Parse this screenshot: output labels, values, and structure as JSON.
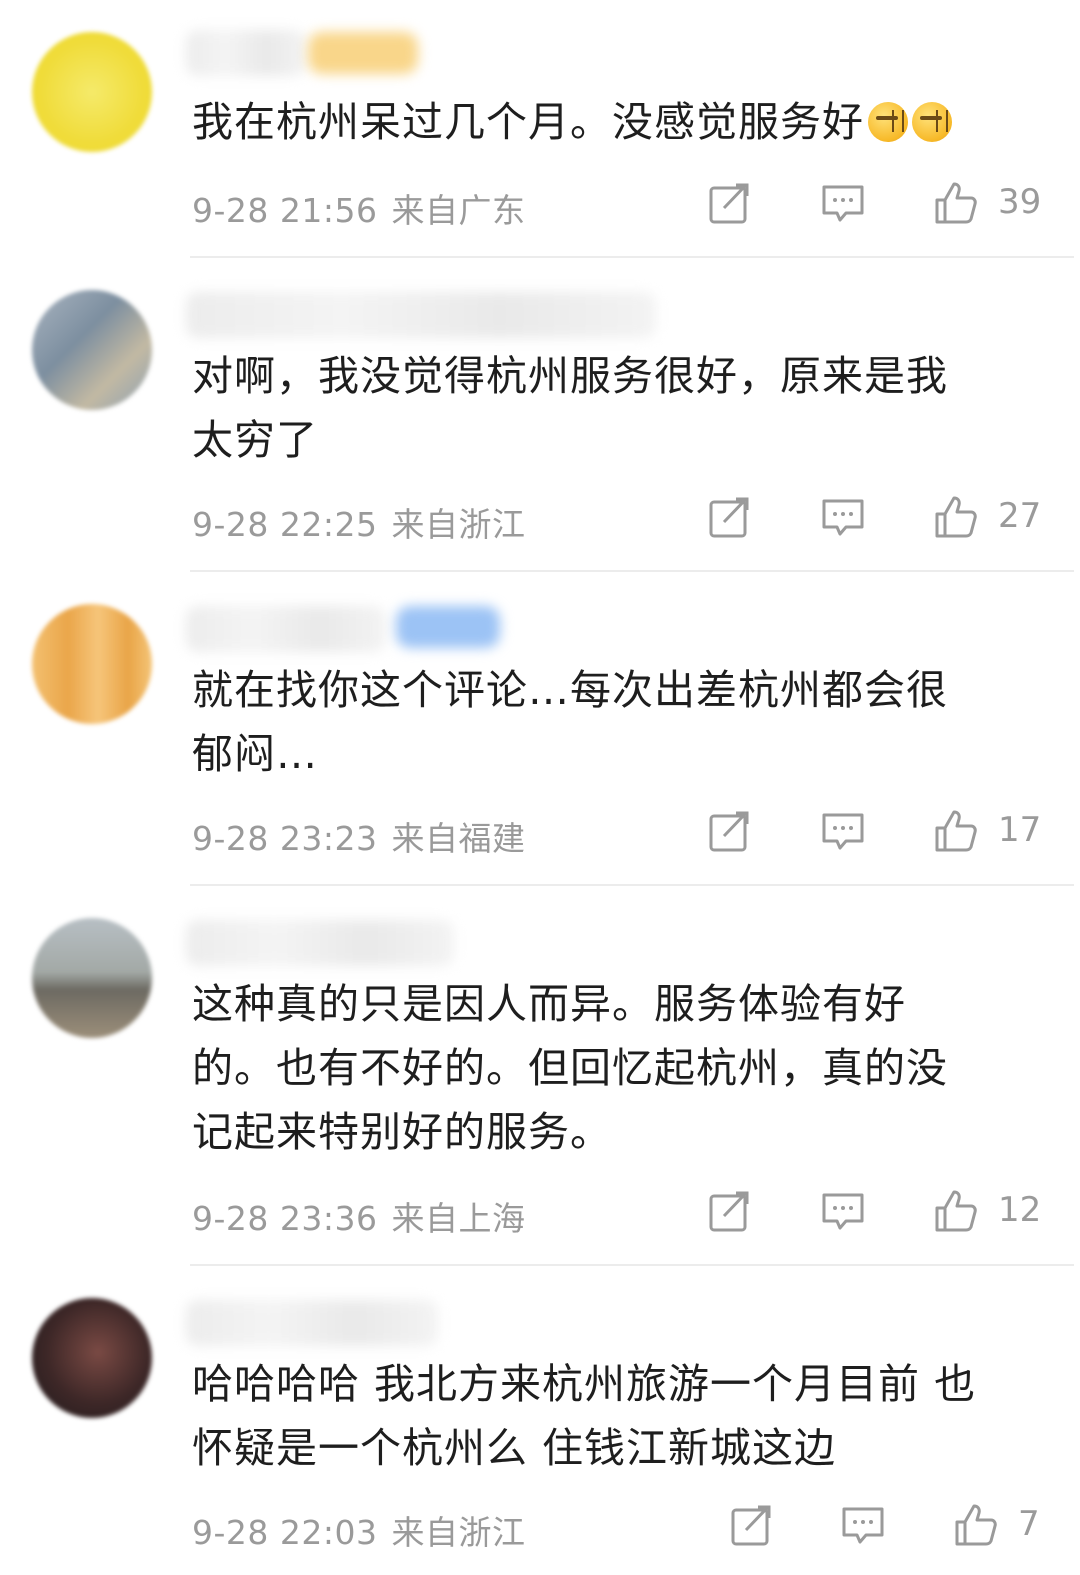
{
  "comments": [
    {
      "text": "我在杭州呆过几个月。没感觉服务好",
      "date": "9-28 21:56",
      "location": "来自广东",
      "likes": "39",
      "emoji_icons": [
        "smirk-emoji-icon",
        "smirk-emoji-icon"
      ],
      "avatar_color": "#f2e04a"
    },
    {
      "text": "对啊，我没觉得杭州服务很好，原来是我\n太穷了",
      "date": "9-28 22:25",
      "location": "来自浙江",
      "likes": "27",
      "avatar_color": "#8c9fb3"
    },
    {
      "text": "就在找你这个评论…每次出差杭州都会很\n郁闷…",
      "date": "9-28 23:23",
      "location": "来自福建",
      "likes": "17",
      "avatar_color": "#f0b25a"
    },
    {
      "text": "这种真的只是因人而异。服务体验有好\n的。也有不好的。但回忆起杭州，真的没\n记起来特别好的服务。",
      "date": "9-28 23:36",
      "location": "来自上海",
      "likes": "12",
      "avatar_color": "#8a8f8c"
    },
    {
      "text": "哈哈哈哈 我北方来杭州旅游一个月目前 也\n怀疑是一个杭州么 住钱江新城这边",
      "date": "9-28 22:03",
      "location": "来自浙江",
      "likes": "7",
      "avatar_color": "#3b2a2a"
    }
  ],
  "icons": {
    "repost": "repost-icon",
    "comment": "comment-icon",
    "like": "thumbs-up-icon"
  },
  "colors": {
    "text": "#1e1e1e",
    "meta": "#9a9a9a",
    "divider": "#ececec"
  }
}
